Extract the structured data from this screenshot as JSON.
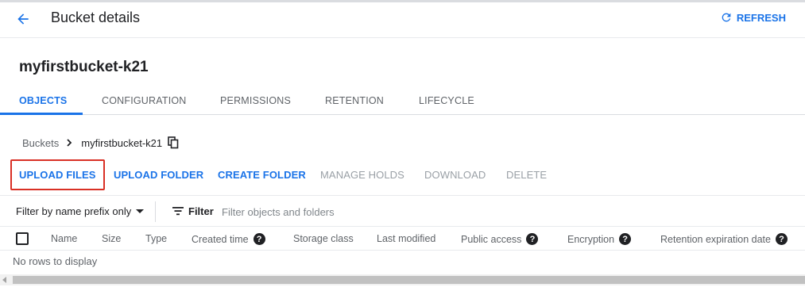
{
  "header": {
    "title": "Bucket details",
    "refresh_label": "REFRESH",
    "back_icon": "arrow-back-icon",
    "refresh_icon": "refresh-icon"
  },
  "bucket": {
    "name": "myfirstbucket-k21"
  },
  "tabs": [
    {
      "label": "OBJECTS",
      "active": true
    },
    {
      "label": "CONFIGURATION"
    },
    {
      "label": "PERMISSIONS"
    },
    {
      "label": "RETENTION"
    },
    {
      "label": "LIFECYCLE"
    }
  ],
  "breadcrumb": {
    "root": "Buckets",
    "current": "myfirstbucket-k21",
    "copy_icon": "copy-icon"
  },
  "actions": [
    {
      "label": "UPLOAD FILES",
      "enabled": true,
      "highlighted": true
    },
    {
      "label": "UPLOAD FOLDER",
      "enabled": true
    },
    {
      "label": "CREATE FOLDER",
      "enabled": true
    },
    {
      "label": "MANAGE HOLDS",
      "enabled": false
    },
    {
      "label": "DOWNLOAD",
      "enabled": false
    },
    {
      "label": "DELETE",
      "enabled": false
    }
  ],
  "filter": {
    "prefix_select": "Filter by name prefix only",
    "label": "Filter",
    "placeholder": "Filter objects and folders"
  },
  "table": {
    "columns": [
      {
        "label": "Name"
      },
      {
        "label": "Size"
      },
      {
        "label": "Type"
      },
      {
        "label": "Created time",
        "help": true
      },
      {
        "label": "Storage class"
      },
      {
        "label": "Last modified"
      },
      {
        "label": "Public access",
        "help": true
      },
      {
        "label": "Encryption",
        "help": true
      },
      {
        "label": "Retention expiration date",
        "help": true
      }
    ],
    "empty_text": "No rows to display",
    "help_glyph": "?"
  },
  "colors": {
    "accent": "#1a73e8",
    "highlight": "#d93025",
    "disabled": "#9aa0a6"
  }
}
